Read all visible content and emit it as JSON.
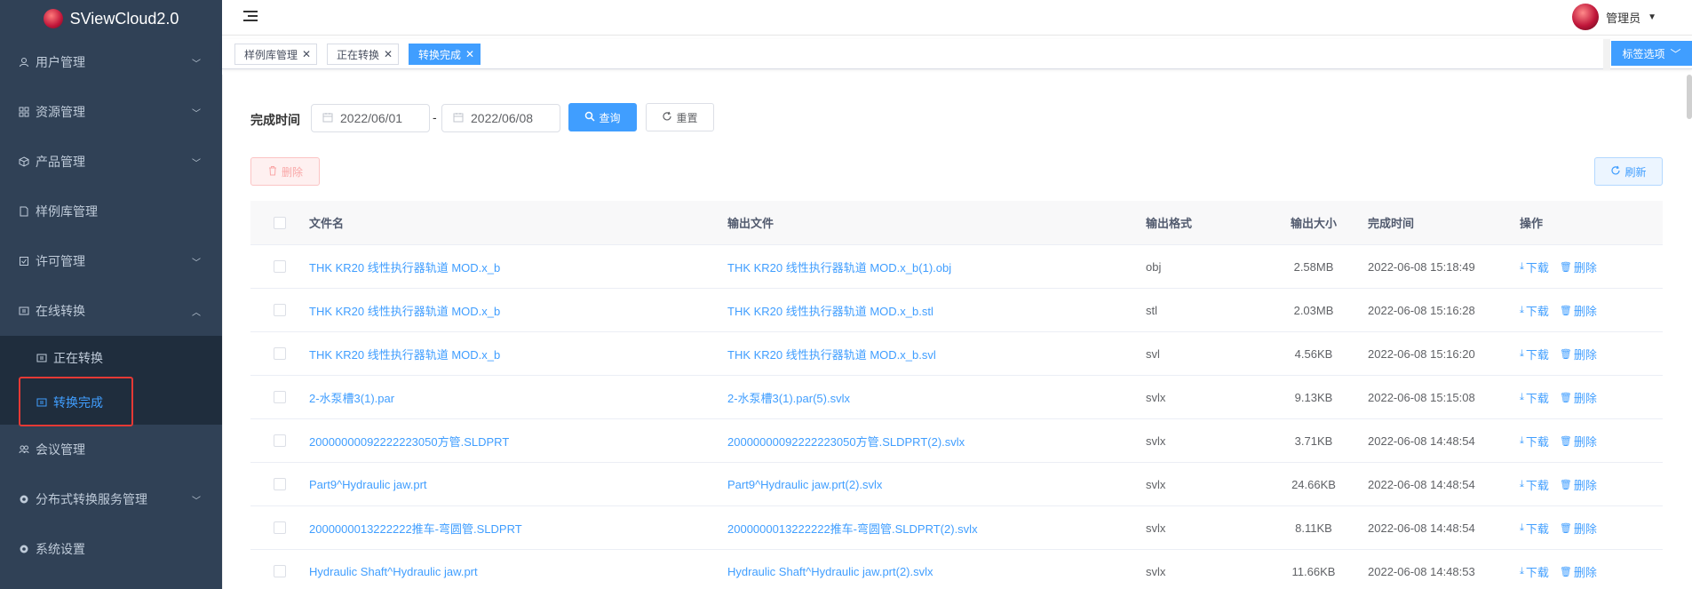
{
  "app": {
    "title": "SViewCloud2.0"
  },
  "sidebar": {
    "items": [
      {
        "label": "用户管理",
        "icon": "user-icon",
        "expandable": true
      },
      {
        "label": "资源管理",
        "icon": "grid-icon",
        "expandable": true
      },
      {
        "label": "产品管理",
        "icon": "box-icon",
        "expandable": true
      },
      {
        "label": "样例库管理",
        "icon": "document-icon",
        "expandable": false
      },
      {
        "label": "许可管理",
        "icon": "checklist-icon",
        "expandable": true
      },
      {
        "label": "在线转换",
        "icon": "convert-icon",
        "expandable": true,
        "expanded": true
      },
      {
        "label": "会议管理",
        "icon": "meeting-icon",
        "expandable": false
      },
      {
        "label": "分布式转换服务管理",
        "icon": "gear-icon",
        "expandable": true
      },
      {
        "label": "系统设置",
        "icon": "gear-icon",
        "expandable": false
      }
    ],
    "subitems": [
      {
        "label": "正在转换",
        "icon": "convert-icon"
      },
      {
        "label": "转换完成",
        "icon": "convert-icon",
        "active": true
      }
    ]
  },
  "header": {
    "user_name": "管理员"
  },
  "tags": {
    "items": [
      {
        "label": "样例库管理"
      },
      {
        "label": "正在转换"
      },
      {
        "label": "转换完成",
        "active": true
      }
    ],
    "options_label": "标签选项"
  },
  "filter": {
    "label": "完成时间",
    "start_date": "2022/06/01",
    "end_date": "2022/06/08",
    "separator": "-",
    "query_label": "查询",
    "reset_label": "重置"
  },
  "toolbar": {
    "delete_label": "删除",
    "refresh_label": "刷新"
  },
  "table": {
    "headers": [
      "文件名",
      "输出文件",
      "输出格式",
      "输出大小",
      "完成时间",
      "操作"
    ],
    "op_download": "下载",
    "op_delete": "删除",
    "rows": [
      {
        "name": "THK KR20 线性执行器轨道 MOD.x_b",
        "output": "THK KR20 线性执行器轨道 MOD.x_b(1).obj",
        "format": "obj",
        "size": "2.58MB",
        "time": "2022-06-08 15:18:49"
      },
      {
        "name": "THK KR20 线性执行器轨道 MOD.x_b",
        "output": "THK KR20 线性执行器轨道 MOD.x_b.stl",
        "format": "stl",
        "size": "2.03MB",
        "time": "2022-06-08 15:16:28"
      },
      {
        "name": "THK KR20 线性执行器轨道 MOD.x_b",
        "output": "THK KR20 线性执行器轨道 MOD.x_b.svl",
        "format": "svl",
        "size": "4.56KB",
        "time": "2022-06-08 15:16:20"
      },
      {
        "name": "2-水泵槽3(1).par",
        "output": "2-水泵槽3(1).par(5).svlx",
        "format": "svlx",
        "size": "9.13KB",
        "time": "2022-06-08 15:15:08"
      },
      {
        "name": "20000000092222223050方管.SLDPRT",
        "output": "20000000092222223050方管.SLDPRT(2).svlx",
        "format": "svlx",
        "size": "3.71KB",
        "time": "2022-06-08 14:48:54"
      },
      {
        "name": "Part9^Hydraulic jaw.prt",
        "output": "Part9^Hydraulic jaw.prt(2).svlx",
        "format": "svlx",
        "size": "24.66KB",
        "time": "2022-06-08 14:48:54"
      },
      {
        "name": "2000000013222222推车-弯圆管.SLDPRT",
        "output": "2000000013222222推车-弯圆管.SLDPRT(2).svlx",
        "format": "svlx",
        "size": "8.11KB",
        "time": "2022-06-08 14:48:54"
      },
      {
        "name": "Hydraulic Shaft^Hydraulic jaw.prt",
        "output": "Hydraulic Shaft^Hydraulic jaw.prt(2).svlx",
        "format": "svlx",
        "size": "11.66KB",
        "time": "2022-06-08 14:48:53"
      }
    ]
  },
  "colors": {
    "sidebar_bg": "#304156",
    "accent": "#409eff",
    "highlight_box": "#e53935"
  }
}
